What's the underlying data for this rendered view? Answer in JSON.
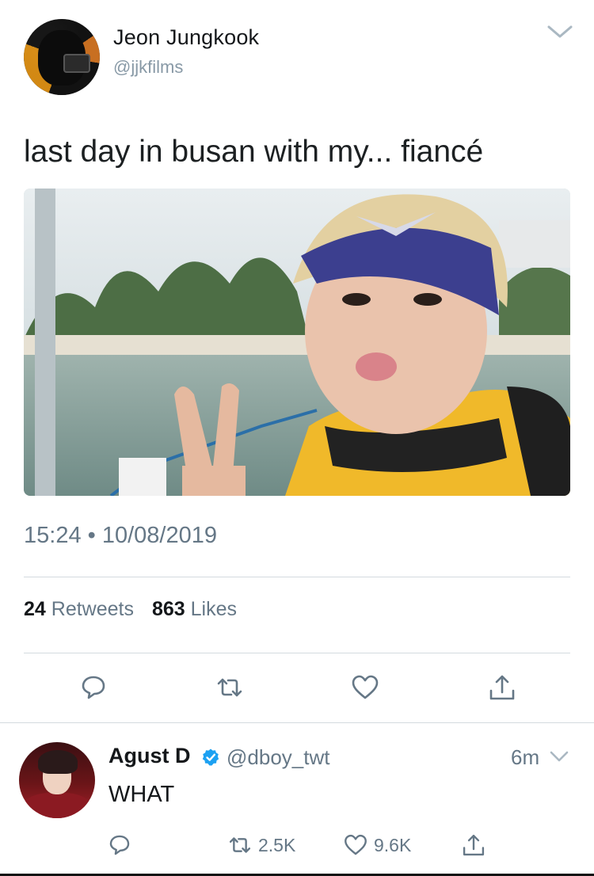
{
  "tweet": {
    "author_name": "Jeon Jungkook",
    "author_handle": "@jjkfilms",
    "text": "last day in busan with my... fiancé",
    "timestamp": "15:24 • 10/08/2019",
    "retweets_count": "24",
    "retweets_label": "Retweets",
    "likes_count": "863",
    "likes_label": "Likes"
  },
  "reply": {
    "author_name": "Agust D",
    "author_handle": "@dboy_twt",
    "time": "6m",
    "text": "WHAT",
    "retweet_count": "2.5K",
    "like_count": "9.6K"
  },
  "colors": {
    "secondary_text": "#657786",
    "verified_blue": "#1da1f2",
    "divider": "#d4dadf"
  },
  "icons": [
    "chevron-down-icon",
    "reply-icon",
    "retweet-icon",
    "like-icon",
    "share-icon",
    "verified-icon"
  ]
}
